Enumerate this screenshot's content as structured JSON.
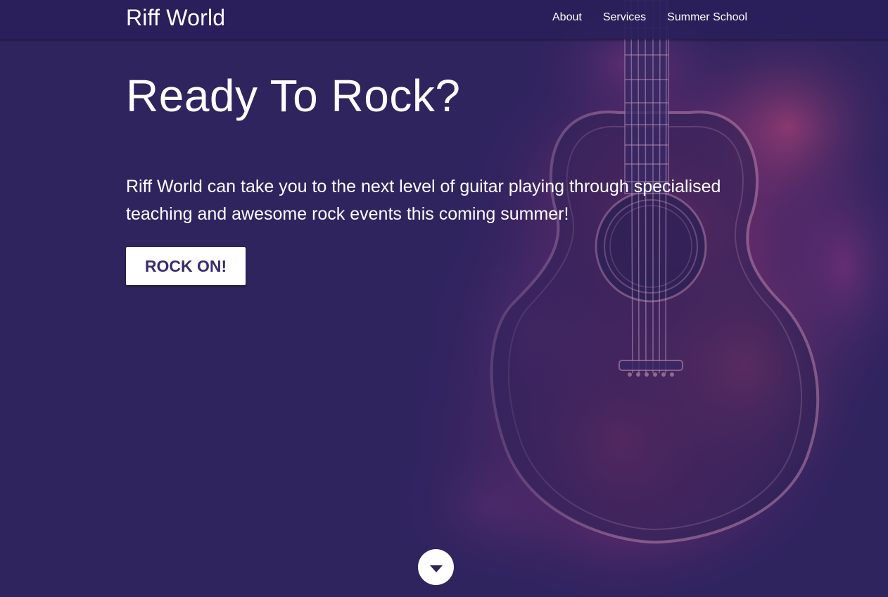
{
  "navbar": {
    "brand": "Riff World",
    "links": [
      {
        "label": "About"
      },
      {
        "label": "Services"
      },
      {
        "label": "Summer School"
      }
    ]
  },
  "hero": {
    "title": "Ready To Rock?",
    "text": "Riff World can take you to the next level of guitar playing through specialised teaching and awesome rock events this coming summer!",
    "cta_label": "ROCK ON!"
  },
  "scroll_button": {
    "icon": "caret-down-icon"
  },
  "colors": {
    "background": "#30245f",
    "accent_purple": "#3b2b6e",
    "smoke_magenta": "#b0346f",
    "text": "#ffffff"
  }
}
